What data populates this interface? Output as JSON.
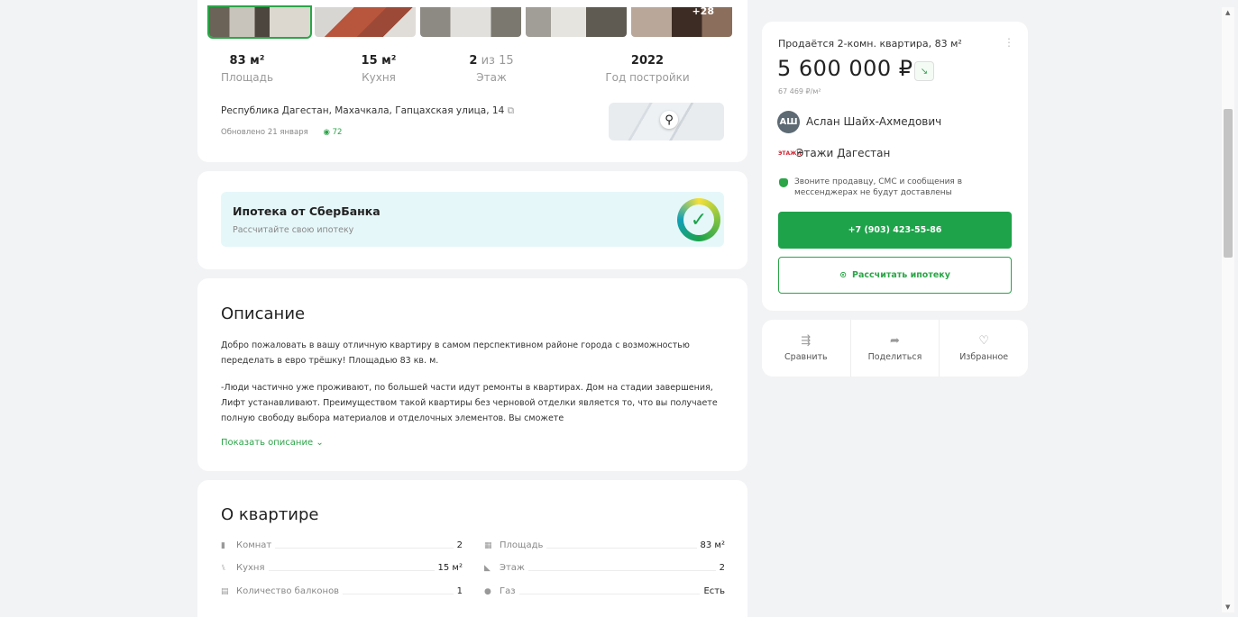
{
  "photos": {
    "more_label": "+28"
  },
  "stats": [
    {
      "value": "83 м²",
      "value_light": "",
      "label": "Площадь"
    },
    {
      "value": "15 м²",
      "value_light": "",
      "label": "Кухня"
    },
    {
      "value": "2",
      "value_light": " из 15",
      "label": "Этаж"
    },
    {
      "value": "2022",
      "value_light": "",
      "label": "Год постройки"
    }
  ],
  "address": "Республика Дагестан, Махачкала, Гапцахская улица, 14",
  "updated": "Обновлено 21 января",
  "views": "72",
  "mortgage_banner": {
    "title": "Ипотека от СберБанка",
    "subtitle": "Рассчитайте свою ипотеку"
  },
  "description": {
    "heading": "Описание",
    "paragraph1": "Добро пожаловать в вашу отличную квартиру в самом перспективном районе города с возможностью переделать в евро трёшку! Площадью 83 кв. м.",
    "paragraph2": "-Люди частично уже проживают, по большей части идут ремонты в квартирах. Дом на стадии завершения, Лифт устанавливают. Преимуществом такой квартиры без черновой отделки является то, что вы получаете полную свободу выбора материалов и отделочных элементов. Вы сможете",
    "show_more": "Показать описание"
  },
  "apartment": {
    "heading": "О квартире",
    "left": [
      {
        "label": "Комнат",
        "value": "2"
      },
      {
        "label": "Кухня",
        "value": "15 м²"
      },
      {
        "label": "Количество балконов",
        "value": "1"
      }
    ],
    "right": [
      {
        "label": "Площадь",
        "value": "83 м²"
      },
      {
        "label": "Этаж",
        "value": "2"
      },
      {
        "label": "Газ",
        "value": "Есть"
      }
    ]
  },
  "offer": {
    "title": "Продаётся 2-комн. квартира, 83 м²",
    "price": "5 600 000 ₽",
    "price_per_m2": "67 469 ₽/м²",
    "seller_initials": "АШ",
    "seller_name": "Аслан Шайх-Ахмедович",
    "agency_logo": "ЭТАЖИ",
    "agency_name": "Этажи Дагестан",
    "notice": "Звоните продавцу, СМС и сообщения в мессенджерах не будут доставлены",
    "phone": "+7 (903) 423-55-86",
    "mortgage_button": "Рассчитать ипотеку"
  },
  "actions": [
    {
      "label": "Сравнить",
      "icon": "compare-icon"
    },
    {
      "label": "Поделиться",
      "icon": "share-icon"
    },
    {
      "label": "Избранное",
      "icon": "heart-icon"
    }
  ],
  "colors": {
    "accent": "#1ea34a",
    "background": "#f2f3f5"
  }
}
